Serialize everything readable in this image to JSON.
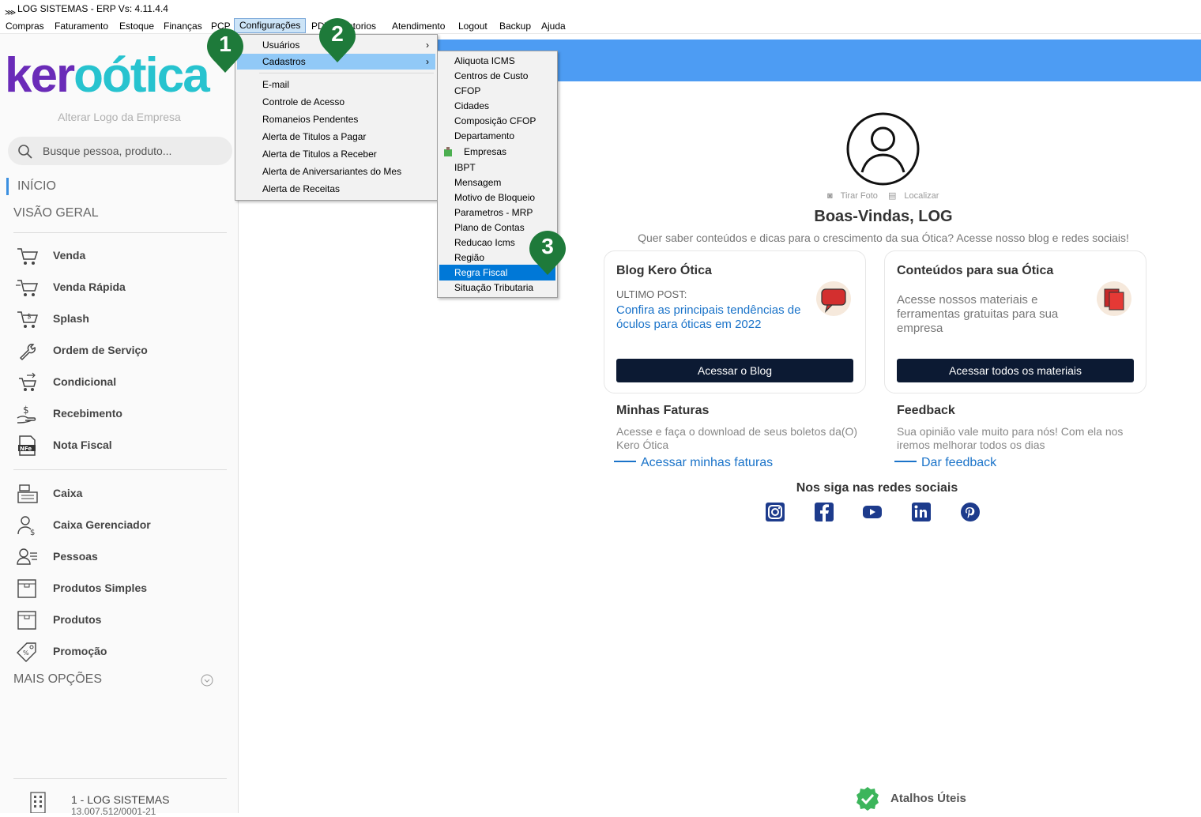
{
  "window": {
    "title": "LOG SISTEMAS - ERP Vs: 4.11.4.4"
  },
  "menubar": [
    {
      "label": "Compras"
    },
    {
      "label": "Faturamento"
    },
    {
      "label": "Estoque"
    },
    {
      "label": "Finanças"
    },
    {
      "label": "PCP"
    },
    {
      "label": "Configurações"
    },
    {
      "label": "PDV"
    },
    {
      "label": "Relatorios"
    },
    {
      "label": "Atendimento"
    },
    {
      "label": "Logout"
    },
    {
      "label": "Backup"
    },
    {
      "label": "Ajuda"
    }
  ],
  "sidebar": {
    "logo_part1": "ker",
    "logo_part2": "oótica",
    "alter_logo": "Alterar Logo da Empresa",
    "search_placeholder": "Busque pessoa, produto...",
    "inicio": "INÍCIO",
    "visao_geral": "VISÃO GERAL",
    "items": [
      {
        "label": "Venda",
        "icon": "cart-icon"
      },
      {
        "label": "Venda Rápida",
        "icon": "fast-cart-icon"
      },
      {
        "label": "Splash",
        "icon": "cart-dollar-icon"
      },
      {
        "label": "Ordem de Serviço",
        "icon": "wrench-icon"
      },
      {
        "label": "Condicional",
        "icon": "cart-arrows-icon"
      },
      {
        "label": "Recebimento",
        "icon": "hand-dollar-icon"
      },
      {
        "label": "Nota Fiscal",
        "icon": "nfe-icon"
      }
    ],
    "items2": [
      {
        "label": "Caixa",
        "icon": "cash-register-icon"
      },
      {
        "label": "Caixa Gerenciador",
        "icon": "user-dollar-icon"
      },
      {
        "label": "Pessoas",
        "icon": "people-icon"
      },
      {
        "label": "Produtos Simples",
        "icon": "box-icon"
      },
      {
        "label": "Produtos",
        "icon": "box-icon"
      },
      {
        "label": "Promoção",
        "icon": "tag-icon"
      }
    ],
    "mais_opcoes": "MAIS OPÇÕES",
    "company_name": "1 - LOG SISTEMAS",
    "company_cnpj": "13.007.512/0001-21"
  },
  "config_menu": [
    {
      "label": "Usuários",
      "submenu": true
    },
    {
      "label": "Cadastros",
      "submenu": true
    },
    {
      "label": "E-mail"
    },
    {
      "label": "Controle de Acesso"
    },
    {
      "label": "Romaneios Pendentes"
    },
    {
      "label": "Alerta de Titulos a Pagar"
    },
    {
      "label": "Alerta de Titulos a Receber"
    },
    {
      "label": "Alerta de Aniversariantes do Mes"
    },
    {
      "label": "Alerta de Receitas"
    }
  ],
  "cadastros_menu": [
    {
      "label": "Aliquota ICMS"
    },
    {
      "label": "Centros de Custo"
    },
    {
      "label": "CFOP"
    },
    {
      "label": "Cidades"
    },
    {
      "label": "Composição CFOP"
    },
    {
      "label": "Departamento"
    },
    {
      "label": "Empresas"
    },
    {
      "label": "IBPT"
    },
    {
      "label": "Mensagem"
    },
    {
      "label": "Motivo de Bloqueio"
    },
    {
      "label": "Parametros - MRP"
    },
    {
      "label": "Plano de Contas"
    },
    {
      "label": "Reducao Icms"
    },
    {
      "label": "Região"
    },
    {
      "label": "Regra Fiscal"
    },
    {
      "label": "Situação Tributaria"
    }
  ],
  "badges": [
    "1",
    "2",
    "3"
  ],
  "main": {
    "tirar_foto": "Tirar Foto",
    "localizar": "Localizar",
    "welcome": "Boas-Vindas, LOG",
    "subtitle": "Quer saber conteúdos e dicas para o crescimento da sua Ótica? Acesse nosso blog e redes sociais!",
    "blog": {
      "title": "Blog Kero Ótica",
      "ultimo_post": "ULTIMO POST:",
      "link": "Confira as principais tendências de óculos para óticas em 2022",
      "button": "Acessar o Blog"
    },
    "conteudos": {
      "title": "Conteúdos para sua Ótica",
      "desc": "Acesse nossos materiais e ferramentas gratuitas para sua empresa",
      "button": "Acessar todos os materiais"
    },
    "faturas": {
      "title": "Minhas Faturas",
      "desc": "Acesse e faça o download de seus boletos da(O) Kero Ótica",
      "link": "Acessar minhas faturas"
    },
    "feedback": {
      "title": "Feedback",
      "desc": "Sua opinião vale muito para nós! Com ela nos iremos melhorar todos os dias",
      "link": "Dar feedback"
    },
    "social_title": "Nos siga nas redes sociais",
    "atalhos": "Atalhos Úteis"
  },
  "colors": {
    "accent_blue": "#4d9cf3",
    "badge_green": "#1e7a3a",
    "menu_select": "#0078d7",
    "dark_button": "#0c1a33"
  }
}
